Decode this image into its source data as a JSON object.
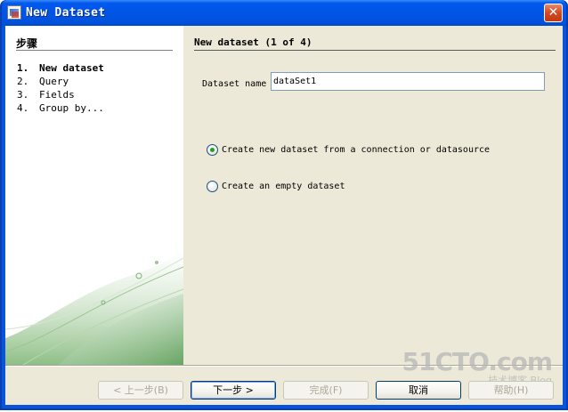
{
  "window": {
    "title": "New Dataset",
    "close_glyph": "✕"
  },
  "steps_panel": {
    "heading": "步骤",
    "items": [
      {
        "num": "1.",
        "label": "New dataset",
        "current": true
      },
      {
        "num": "2.",
        "label": "Query",
        "current": false
      },
      {
        "num": "3.",
        "label": "Fields",
        "current": false
      },
      {
        "num": "4.",
        "label": "Group by...",
        "current": false
      }
    ]
  },
  "main": {
    "heading": "New dataset (1 of 4)",
    "dataset_name_label": "Dataset name",
    "dataset_name_value": "dataSet1",
    "options": [
      {
        "label": "Create new dataset from a connection or datasource",
        "checked": true
      },
      {
        "label": "Create an empty dataset",
        "checked": false
      }
    ]
  },
  "buttons": {
    "back": "< 上一步(B)",
    "next": "下一步 >",
    "finish": "完成(F)",
    "cancel": "取消",
    "help": "帮助(H)"
  },
  "watermark": {
    "line1": "51CTO.com",
    "line2": "技术博客 Blog"
  },
  "colors": {
    "titlebar": "#0055e5",
    "client_bg": "#ece9d8",
    "radio_dot": "#21a121"
  }
}
